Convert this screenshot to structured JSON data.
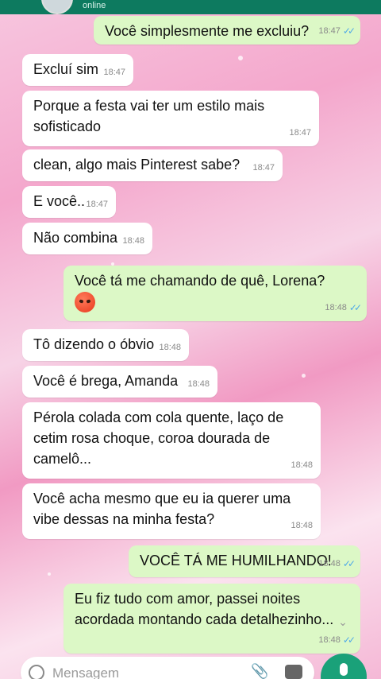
{
  "header": {
    "status": "online"
  },
  "messages": [
    {
      "side": "out",
      "text": "Você simplesmente me excluiu?",
      "time": "18:47"
    },
    {
      "side": "in",
      "text": "Excluí sim",
      "time": "18:47"
    },
    {
      "side": "in",
      "text": "Porque a festa vai ter um estilo mais sofisticado",
      "time": "18:47"
    },
    {
      "side": "in",
      "text": "clean, algo mais Pinterest sabe?",
      "time": "18:47"
    },
    {
      "side": "in",
      "text": "E você..",
      "time": "18:47"
    },
    {
      "side": "in",
      "text": "Não combina",
      "time": "18:48"
    },
    {
      "side": "out",
      "text": "Você tá me chamando de quê, Lorena?",
      "time": "18:48"
    },
    {
      "side": "in",
      "text": "Tô dizendo o óbvio",
      "time": "18:48"
    },
    {
      "side": "in",
      "text": "Você é brega, Amanda",
      "time": "18:48"
    },
    {
      "side": "in",
      "text": "Pérola colada com cola quente, laço de cetim rosa choque, coroa dourada de camelô...",
      "time": "18:48"
    },
    {
      "side": "in",
      "text": "Você acha mesmo que eu ia querer uma vibe dessas na minha festa?",
      "time": "18:48"
    },
    {
      "side": "out",
      "text": "VOCÊ TÁ ME HUMILHANDO!",
      "time": "18:48"
    },
    {
      "side": "out",
      "text": "Eu fiz tudo com amor, passei noites acordada montando cada detalhezinho...",
      "time": "18:48"
    }
  ],
  "composer": {
    "placeholder": "Mensagem"
  },
  "colors": {
    "incoming": "#ffffff",
    "outgoing": "#dcf8c6",
    "accent": "#1aa179",
    "ticks": "#4fa9e8"
  },
  "icons": [
    "emoji-icon",
    "attach-icon",
    "camera-icon",
    "mic-icon",
    "chevron-down-icon",
    "double-check-icon"
  ]
}
